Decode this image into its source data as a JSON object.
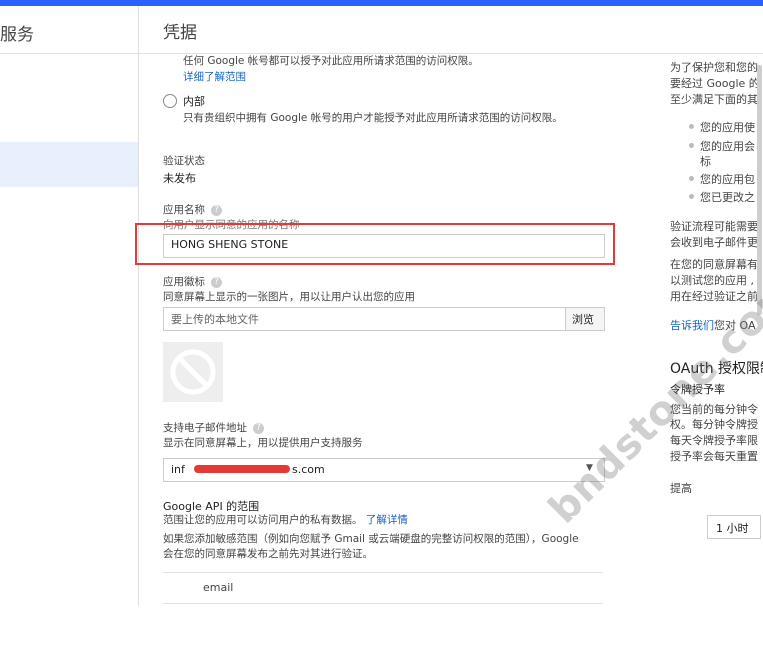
{
  "sidebar": {
    "title": "服务"
  },
  "header": {
    "title": "凭据"
  },
  "audience": {
    "public_desc": "任何 Google 帐号都可以授予对此应用所请求范围的访问权限。",
    "learn_more": "详细了解范围",
    "internal_label": "内部",
    "internal_desc": "只有贵组织中拥有 Google 帐号的用户才能授予对此应用所请求范围的访问权限。"
  },
  "verification": {
    "label": "验证状态",
    "value": "未发布"
  },
  "app_name": {
    "label": "应用名称",
    "desc": "向用户显示同意的应用的名称",
    "value": "HONG SHENG STONE"
  },
  "app_logo": {
    "label": "应用徽标",
    "desc": "同意屏幕上显示的一张图片，用以让用户认出您的应用",
    "placeholder": "要上传的本地文件",
    "browse": "浏览"
  },
  "support_email": {
    "label": "支持电子邮件地址",
    "desc": "显示在同意屏幕上，用以提供用户支持服务",
    "value_prefix": "inf",
    "value_suffix": "s.com"
  },
  "scopes": {
    "label": "Google API 的范围",
    "desc": "范围让您的应用可以访问用户的私有数据。",
    "learn_more": "了解详情",
    "note1": "如果您添加敏感范围（例如向您赋予 Gmail 或云端硬盘的完整访问权限的范围），Google",
    "note2": "会在您的同意屏幕发布之前先对其进行验证。",
    "item": "email"
  },
  "right_panel": {
    "p1": [
      "为了保护您和您的",
      "要经过 Google 的",
      "至少满足下面的其"
    ],
    "bullets": [
      "您的应用使",
      "您的应用会",
      "标",
      "您的应用包",
      "您已更改之"
    ],
    "p2": [
      "验证流程可能需要",
      "会收到电子邮件更"
    ],
    "p3": [
      "在您的同意屏幕有",
      "以测试您的应用 ,",
      "用在经过验证之前"
    ],
    "tell_us_link": "告诉我们",
    "tell_us_rest": "您对 OA",
    "oauth_title": "OAuth 授权限制",
    "rate_title": "令牌授予率",
    "rate_lines": [
      "您当前的每分钟令",
      "权。每分钟令牌授",
      "每天令牌授予率限",
      "授予率会每天重置"
    ],
    "raise_link": "提高",
    "time_select": "1 小时"
  },
  "watermark": "bndstone.com"
}
